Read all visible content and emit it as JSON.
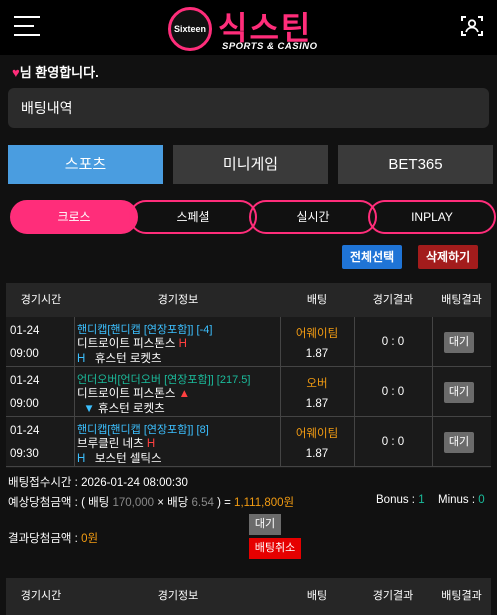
{
  "header": {
    "logo_badge": "Sixteen",
    "logo_title": "식스틴",
    "logo_subtitle": "SPORTS & CASINO",
    "menu_icon": "hamburger-menu-icon",
    "user_icon": "user-scan-icon"
  },
  "welcome": {
    "heart": "♥",
    "text": "님 환영합니다."
  },
  "page_title": "배팅내역",
  "tabs": [
    {
      "label": "스포츠",
      "active": true
    },
    {
      "label": "미니게임",
      "active": false
    },
    {
      "label": "BET365",
      "active": false
    }
  ],
  "filters": [
    {
      "label": "크로스",
      "active": true
    },
    {
      "label": "스페셜",
      "active": false
    },
    {
      "label": "실시간",
      "active": false
    },
    {
      "label": "INPLAY",
      "active": false
    }
  ],
  "actions": {
    "select_all": "전체선택",
    "delete": "삭제하기",
    "select_all_color": "#1f74d6",
    "delete_color": "#a31c1c"
  },
  "columns": [
    "경기시간",
    "경기정보",
    "배팅",
    "경기결과",
    "배팅결과"
  ],
  "bets": [
    {
      "date": "01-24",
      "time": "09:00",
      "market": "핸디캡[핸디캡 [연장포함]] [-4]",
      "home": "디트로이트 피스톤스",
      "home_mark": "H",
      "away_mark": "H",
      "away": "휴스턴 로켓츠",
      "pick": "어웨이팀",
      "odds": "1.87",
      "result": "0 : 0",
      "status": "대기"
    },
    {
      "date": "01-24",
      "time": "09:00",
      "market": "언더오버[언더오버 [연장포함]] [217.5]",
      "home": "디트로이트 피스톤스",
      "home_mark": "▲",
      "away_mark": "▼",
      "away": "휴스턴 로켓츠",
      "pick": "오버",
      "odds": "1.87",
      "result": "0 : 0",
      "status": "대기"
    },
    {
      "date": "01-24",
      "time": "09:30",
      "market": "핸디캡[핸디캡 [연장포함]] [8]",
      "home": "브루클린 네츠",
      "home_mark": "H",
      "away_mark": "H",
      "away": "보스턴 셀틱스",
      "pick": "어웨이팀",
      "odds": "1.87",
      "result": "0 : 0",
      "status": "대기"
    }
  ],
  "summary": {
    "bet_time_label": "배팅접수시간 : ",
    "bet_time": "2026-01-24 08:00:30",
    "expected_label": "예상당첨금액 : ( 배팅 ",
    "stake": "170,000",
    "times": "×",
    "odds_label": "배당 ",
    "total_odds": "6.54",
    "equals": ") = ",
    "expected_amount": "1,111,800원",
    "bonus_label": "Bonus : ",
    "bonus": "1",
    "minus_label": "Minus : ",
    "minus": "0",
    "result_label": "결과당첨금액 : ",
    "result_amount": "0원",
    "status": "대기",
    "cancel": "배팅취소"
  }
}
